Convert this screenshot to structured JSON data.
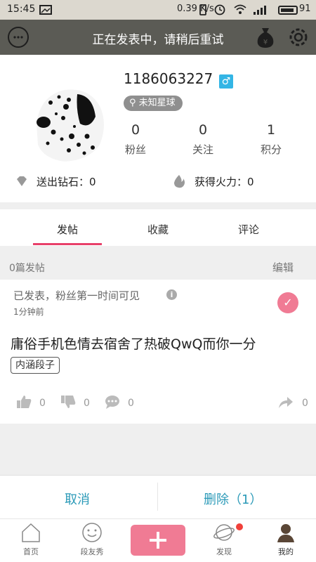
{
  "status_bar": {
    "time": "15:45",
    "speed": "0.39 K/s",
    "battery": "91"
  },
  "header": {
    "title": "正在发表中，请稍后重试"
  },
  "profile": {
    "username": "1186063227",
    "gender_symbol": "♂",
    "planet": "未知星球",
    "stats": [
      {
        "value": "0",
        "label": "粉丝"
      },
      {
        "value": "0",
        "label": "关注"
      },
      {
        "value": "1",
        "label": "积分"
      }
    ],
    "diamonds": "送出钻石：0",
    "fire": "获得火力：0"
  },
  "tabs": [
    "发帖",
    "收藏",
    "评论"
  ],
  "list_header": {
    "count": "0篇发帖",
    "edit": "编辑"
  },
  "post": {
    "status": "已发表，粉丝第一时间可见",
    "time": "1分钟前",
    "content": "庸俗手机色情去宿舍了热破QwQ而你一分",
    "tag": "内涵段子",
    "likes": "0",
    "dislikes": "0",
    "comments": "0",
    "shares": "0"
  },
  "action_bar": {
    "cancel": "取消",
    "delete": "删除（1）"
  },
  "bottom_nav": [
    {
      "label": "首页"
    },
    {
      "label": "段友秀"
    },
    {
      "label": "发现"
    },
    {
      "label": "我的"
    }
  ],
  "colors": {
    "accent_pink": "#f07b94",
    "tab_underline": "#e8406a",
    "action_blue": "#2b9ab8",
    "header_bg": "#5b5b55"
  }
}
